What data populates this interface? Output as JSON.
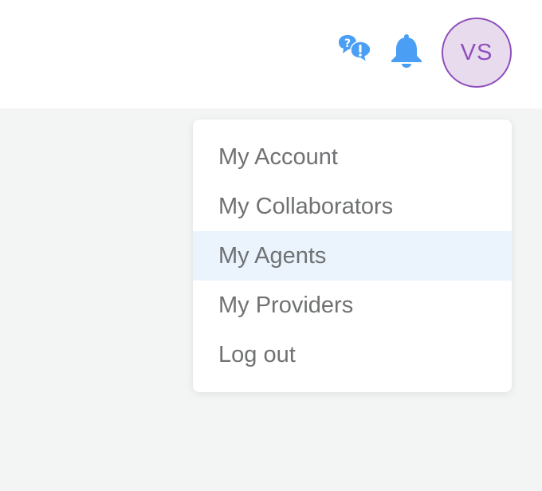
{
  "header": {
    "avatar_initials": "VS",
    "help_icon": "help-chat-icon",
    "notification_icon": "bell-icon"
  },
  "user_menu": {
    "items": [
      {
        "label": "My Account",
        "highlighted": false
      },
      {
        "label": "My Collaborators",
        "highlighted": false
      },
      {
        "label": "My Agents",
        "highlighted": true
      },
      {
        "label": "My Providers",
        "highlighted": false
      },
      {
        "label": "Log out",
        "highlighted": false
      }
    ]
  },
  "colors": {
    "icon_blue": "#4a9ff5",
    "avatar_purple": "#8e4fbc",
    "avatar_bg": "#e8dbee",
    "highlight_bg": "#ebf4fd",
    "menu_text": "#6f7173",
    "page_bg": "#f3f4f4"
  }
}
